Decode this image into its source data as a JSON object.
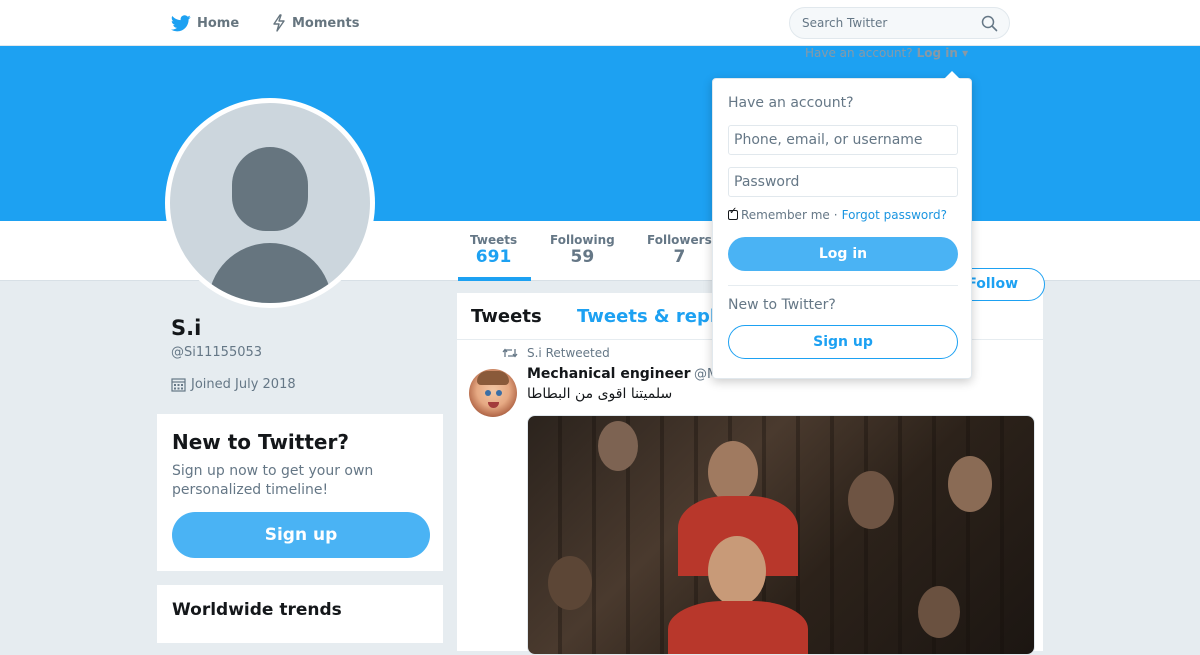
{
  "nav": {
    "home_label": "Home",
    "moments_label": "Moments",
    "search_placeholder": "Search Twitter"
  },
  "login_hint": {
    "text": "Have an account?",
    "link": "Log in"
  },
  "profile": {
    "name": "S.i",
    "handle": "@Si11155053",
    "joined": "Joined July 2018",
    "stats": {
      "tweets_label": "Tweets",
      "tweets_value": "691",
      "following_label": "Following",
      "following_value": "59",
      "followers_label": "Followers",
      "followers_value": "7"
    },
    "follow_label": "Follow"
  },
  "signup_card": {
    "title": "New to Twitter?",
    "text": "Sign up now to get your own personalized timeline!",
    "button": "Sign up"
  },
  "trends_card": {
    "title": "Worldwide trends"
  },
  "timeline": {
    "tabs": [
      "Tweets",
      "Tweets & repl"
    ],
    "tweet": {
      "retweet_context": "S.i Retweeted",
      "author": "Mechanical engineer",
      "handle": "@M",
      "text": "سلميتنا اقوى من البطاطا"
    }
  },
  "login_dropdown": {
    "title": "Have an account?",
    "username_placeholder": "Phone, email, or username",
    "password_placeholder": "Password",
    "remember_label": "Remember me",
    "separator": "·",
    "forgot_label": "Forgot password?",
    "login_button": "Log in",
    "new_label": "New to Twitter?",
    "signup_button": "Sign up"
  },
  "colors": {
    "brand": "#1da1f2",
    "button_fill": "#4ab3f4",
    "background": "#e6ecf0"
  },
  "icons": [
    "twitter-bird-icon",
    "lightning-icon",
    "search-icon",
    "calendar-icon",
    "retweet-icon",
    "caret-down-icon",
    "checkbox-icon"
  ]
}
